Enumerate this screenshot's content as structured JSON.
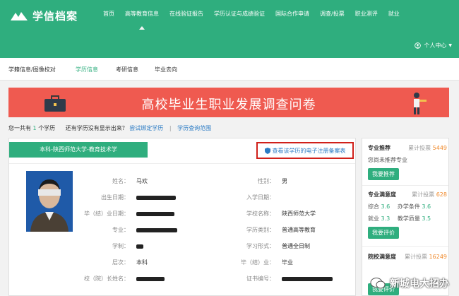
{
  "header": {
    "logo_text": "学信档案",
    "nav": [
      "首页",
      "高等教育信息",
      "在线验证报告",
      "学历认证与成绩验证",
      "国际合作申请",
      "调查/投票",
      "职业测评",
      "就业"
    ],
    "user_center": "个人中心"
  },
  "subnav": [
    "学籍信息/图像校对",
    "学历信息",
    "考研信息",
    "毕业去向"
  ],
  "banner": {
    "title": "高校毕业生职业发展调查问卷"
  },
  "count_line": {
    "prefix": "您一共有",
    "count": "1",
    "unit": "个学历",
    "question": "还有学历没有显示出来？",
    "bind_link": "尝试绑定学历",
    "scope_link": "学历查询范围"
  },
  "card": {
    "school_tag": "本科-陕西师范大学-教育技术学",
    "record_link": "查看该学历的电子注册备案表",
    "left_fields": [
      {
        "label": "姓名：",
        "value": "马欢"
      },
      {
        "label": "出生日期：",
        "value": ""
      },
      {
        "label": "毕（结）业日期：",
        "value": ""
      },
      {
        "label": "专业：",
        "value": ""
      },
      {
        "label": "学制：",
        "value": ""
      },
      {
        "label": "层次：",
        "value": "本科"
      },
      {
        "label": "校（院）长姓名：",
        "value": ""
      }
    ],
    "right_fields": [
      {
        "label": "性别：",
        "value": "男"
      },
      {
        "label": "入学日期：",
        "value": ""
      },
      {
        "label": "学校名称：",
        "value": "陕西师范大学"
      },
      {
        "label": "学历类别：",
        "value": "普通高等教育"
      },
      {
        "label": "学习形式：",
        "value": "普通全日制"
      },
      {
        "label": "毕（结）业：",
        "value": "毕业"
      },
      {
        "label": "证书编号：",
        "value": ""
      }
    ]
  },
  "sidebar": {
    "major_recommend": {
      "title": "专业推荐",
      "votes_label": "累计投票",
      "votes": "5449",
      "line": "您尚未推荐专业",
      "button": "我要推荐"
    },
    "major_satisfaction": {
      "title": "专业满意度",
      "votes_label": "累计投票",
      "votes": "628",
      "rows": [
        [
          "综合",
          "3.6",
          "办学条件",
          "3.6"
        ],
        [
          "就业",
          "3.3",
          "教学质量",
          "3.5"
        ]
      ],
      "button": "我要评价"
    },
    "school_satisfaction": {
      "title": "院校满意度",
      "votes_label": "累计投票",
      "votes": "16249",
      "button": "我要评价"
    }
  },
  "watermark": {
    "text": "新城电大招办"
  },
  "colors": {
    "brand": "#2fae7e",
    "banner": "#ef5a50",
    "highlight_border": "#d0201a",
    "link": "#2b7bc4",
    "votes": "#f08a2c"
  }
}
